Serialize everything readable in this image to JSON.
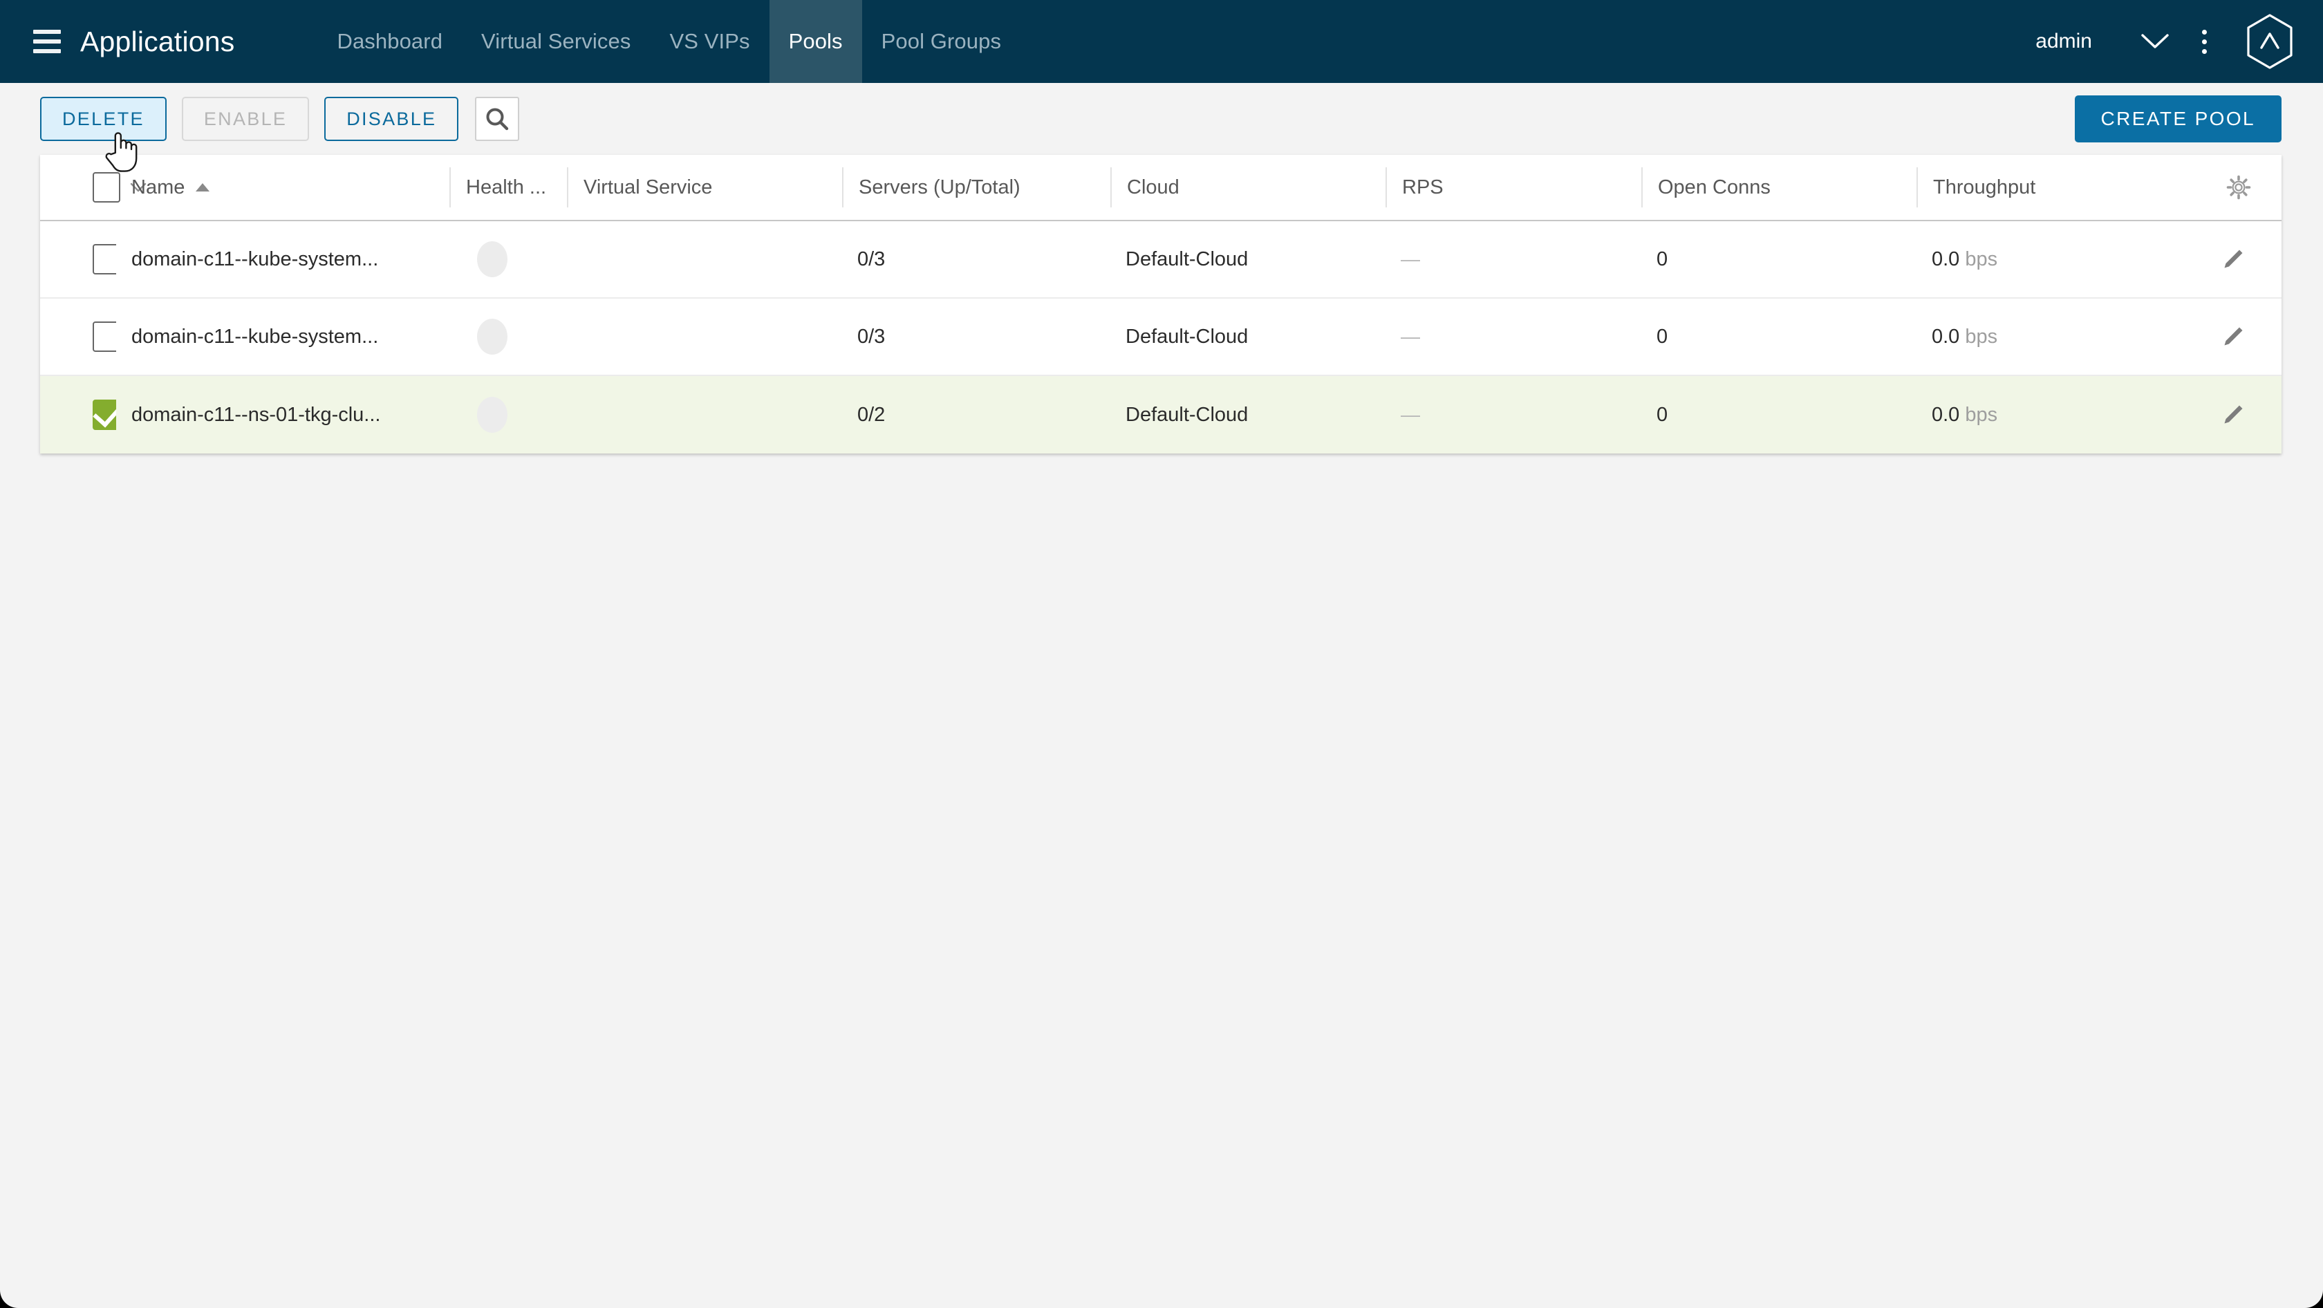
{
  "header": {
    "menu_icon": "hamburger-icon",
    "title": "Applications",
    "nav": [
      {
        "label": "Dashboard",
        "active": false
      },
      {
        "label": "Virtual Services",
        "active": false
      },
      {
        "label": "VS VIPs",
        "active": false
      },
      {
        "label": "Pools",
        "active": true
      },
      {
        "label": "Pool Groups",
        "active": false
      }
    ],
    "user": "admin",
    "chevron_icon": "chevron-down-icon",
    "kebab_icon": "kebab-menu-icon",
    "logo_icon": "avi-hexagon-logo-icon",
    "bg_color": "#04364f",
    "active_tab_color": "#2c5568"
  },
  "toolbar": {
    "delete_label": "DELETE",
    "enable_label": "ENABLE",
    "disable_label": "DISABLE",
    "search_icon": "search-icon",
    "create_label": "CREATE POOL",
    "primary_color": "#0b6fa4",
    "outline_color": "#0b6a9c",
    "delete_hover_bg": "#dcf0fb"
  },
  "table": {
    "columns": [
      {
        "key": "check",
        "label": ""
      },
      {
        "key": "name",
        "label": "Name",
        "sorted": "asc"
      },
      {
        "key": "health",
        "label": "Health ..."
      },
      {
        "key": "virtual_service",
        "label": "Virtual Service"
      },
      {
        "key": "servers",
        "label": "Servers (Up/Total)"
      },
      {
        "key": "cloud",
        "label": "Cloud"
      },
      {
        "key": "rps",
        "label": "RPS"
      },
      {
        "key": "open_conns",
        "label": "Open Conns"
      },
      {
        "key": "throughput",
        "label": "Throughput"
      }
    ],
    "settings_icon": "gear-icon",
    "edit_icon": "pencil-edit-icon",
    "selected_row_color": "#f1f6e6",
    "checkbox_checked_color": "#84ad2e",
    "rows": [
      {
        "selected": false,
        "name": "domain-c11--kube-system...",
        "health": "",
        "virtual_service": "",
        "servers": "0/3",
        "cloud": "Default-Cloud",
        "rps": "—",
        "open_conns": "0",
        "throughput_value": "0.0",
        "throughput_unit": "bps"
      },
      {
        "selected": false,
        "name": "domain-c11--kube-system...",
        "health": "",
        "virtual_service": "",
        "servers": "0/3",
        "cloud": "Default-Cloud",
        "rps": "—",
        "open_conns": "0",
        "throughput_value": "0.0",
        "throughput_unit": "bps"
      },
      {
        "selected": true,
        "name": "domain-c11--ns-01-tkg-clu...",
        "health": "",
        "virtual_service": "",
        "servers": "0/2",
        "cloud": "Default-Cloud",
        "rps": "—",
        "open_conns": "0",
        "throughput_value": "0.0",
        "throughput_unit": "bps"
      }
    ]
  },
  "cursor": {
    "type": "pointing-hand-cursor"
  }
}
